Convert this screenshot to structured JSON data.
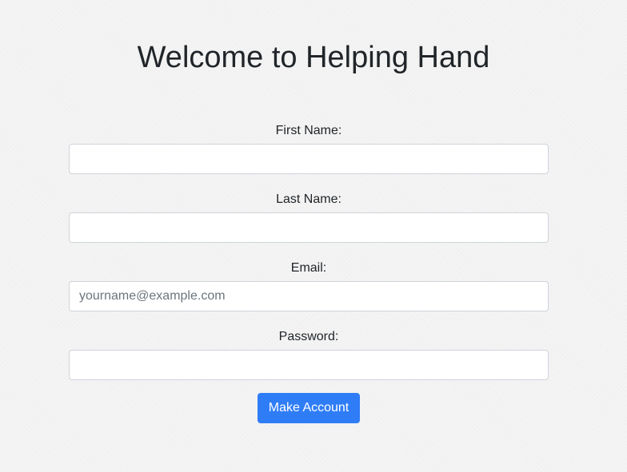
{
  "page": {
    "title": "Welcome to Helping Hand"
  },
  "form": {
    "first_name": {
      "label": "First Name:",
      "value": "",
      "placeholder": ""
    },
    "last_name": {
      "label": "Last Name:",
      "value": "",
      "placeholder": ""
    },
    "email": {
      "label": "Email:",
      "value": "",
      "placeholder": "yourname@example.com"
    },
    "password": {
      "label": "Password:",
      "value": "",
      "placeholder": ""
    },
    "submit_label": "Make Account"
  },
  "colors": {
    "primary_button": "#2f7df6",
    "background": "#f2f2f2",
    "text": "#212529"
  }
}
